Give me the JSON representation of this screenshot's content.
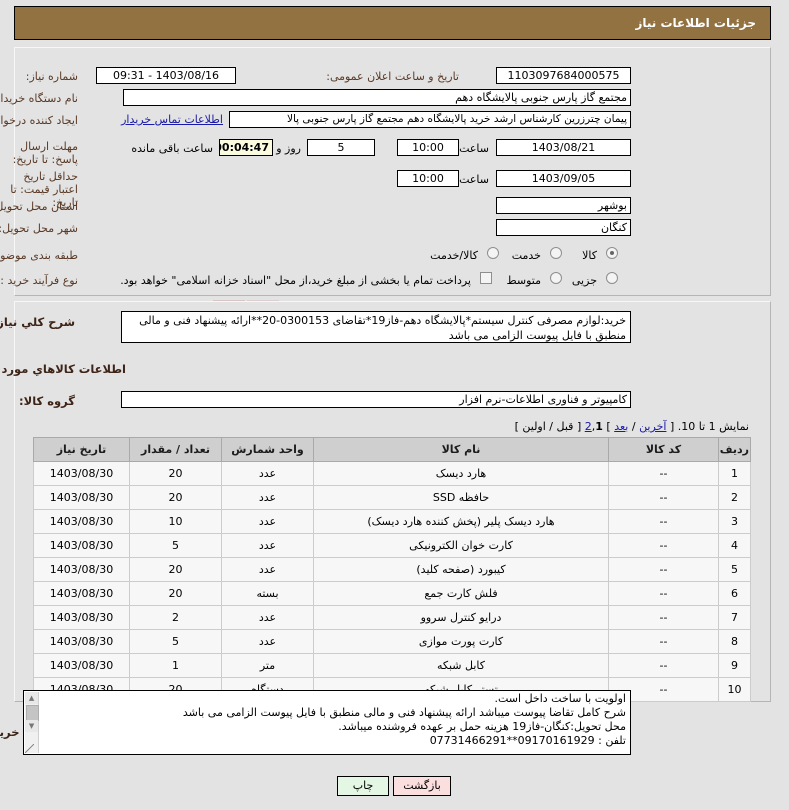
{
  "header": {
    "title": "جزئیات اطلاعات نیاز"
  },
  "form": {
    "need_number_label": "شماره نیاز:",
    "need_number_value": "1103097684000575",
    "announce_datetime_label": "تاریخ و ساعت اعلان عمومی:",
    "announce_datetime_value": "1403/08/16 - 09:31",
    "buyer_org_label": "نام دستگاه خریدار:",
    "buyer_org_value": "مجتمع گاز پارس جنوبی  پالایشگاه دهم",
    "requester_label": "ایجاد کننده درخواست:",
    "requester_value": "پیمان چترزرین کارشناس ارشد خرید پالایشگاه دهم مجتمع گاز پارس جنوبی  پالا",
    "buyer_contact_link": "اطلاعات تماس خریدار",
    "response_deadline_label": "مهلت ارسال پاسخ: تا تاریخ:",
    "response_deadline_date": "1403/08/21",
    "hour_label": "ساعت",
    "response_deadline_time": "10:00",
    "days_value": "5",
    "days_suffix_label": "روز و",
    "countdown_value": "00:04:47",
    "countdown_suffix_label": "ساعت باقی مانده",
    "price_validity_label": "حداقل تاریخ اعتبار قیمت: تا تاریخ:",
    "price_validity_date": "1403/09/05",
    "price_validity_time": "10:00",
    "province_label": "استان محل تحویل:",
    "province_value": "بوشهر",
    "city_label": "شهر محل تحویل:",
    "city_value": "کنگان",
    "category_label": "طبقه بندی موضوعی:",
    "category_options": [
      {
        "label": "کالا",
        "selected": true
      },
      {
        "label": "خدمت",
        "selected": false
      },
      {
        "label": "کالا/خدمت",
        "selected": false
      }
    ],
    "process_type_label": "نوع فرآیند خرید :",
    "process_type_options": [
      {
        "label": "جزیی",
        "selected": false
      },
      {
        "label": "متوسط",
        "selected": false
      }
    ],
    "treasury_checkbox_label": "پرداخت تمام یا بخشی از مبلغ خرید،از محل \"اسناد خزانه اسلامی\" خواهد بود.",
    "treasury_checked": false
  },
  "description": {
    "label": "شرح کلي نياز:",
    "value": "خرید:لوازم مصرفی کنترل سیستم*پالایشگاه دهم-فاز19*تقاضای 0300153-20**ارائه پیشنهاد فنی و مالی منطبق با فایل پیوست الزامی می باشد"
  },
  "goods_section": {
    "heading": "اطلاعات کالاهاي مورد نياز",
    "group_label": "گروه کالا:",
    "group_value": "کامپیوتر و فناوری اطلاعات-نرم افزار"
  },
  "pagination": {
    "prefix": "نمایش 1 تا 10. [",
    "last_link": "آخرین",
    "sep1": "/",
    "next_link": "بعد",
    "bracket_close": "]",
    "page2": "2",
    "comma": ",",
    "page1_current": "1",
    "bracket_open": "[",
    "prev_text": "قبل",
    "sep2": "/",
    "first_text": "اولین",
    "bracket_close2": "]"
  },
  "table": {
    "columns": [
      "ردیف",
      "کد کالا",
      "نام کالا",
      "واحد شمارش",
      "تعداد / مقدار",
      "تاریخ نیاز"
    ],
    "rows": [
      {
        "row": "1",
        "code": "--",
        "name": "هارد دیسک",
        "unit": "عدد",
        "qty": "20",
        "date": "1403/08/30"
      },
      {
        "row": "2",
        "code": "--",
        "name": "حافظه SSD",
        "unit": "عدد",
        "qty": "20",
        "date": "1403/08/30"
      },
      {
        "row": "3",
        "code": "--",
        "name": "هارد دیسک پلیر (پخش کننده هارد دیسک)",
        "unit": "عدد",
        "qty": "10",
        "date": "1403/08/30"
      },
      {
        "row": "4",
        "code": "--",
        "name": "کارت خوان الکترونیکی",
        "unit": "عدد",
        "qty": "5",
        "date": "1403/08/30"
      },
      {
        "row": "5",
        "code": "--",
        "name": "کیبورد (صفحه کلید)",
        "unit": "عدد",
        "qty": "20",
        "date": "1403/08/30"
      },
      {
        "row": "6",
        "code": "--",
        "name": "فلش کارت جمع",
        "unit": "بسته",
        "qty": "20",
        "date": "1403/08/30"
      },
      {
        "row": "7",
        "code": "--",
        "name": "درایو کنترل سروو",
        "unit": "عدد",
        "qty": "2",
        "date": "1403/08/30"
      },
      {
        "row": "8",
        "code": "--",
        "name": "کارت پورت موازی",
        "unit": "عدد",
        "qty": "5",
        "date": "1403/08/30"
      },
      {
        "row": "9",
        "code": "--",
        "name": "کابل شبکه",
        "unit": "متر",
        "qty": "1",
        "date": "1403/08/30"
      },
      {
        "row": "10",
        "code": "--",
        "name": "تستر کابل شبکه",
        "unit": "دستگاه",
        "qty": "20",
        "date": "1403/08/30"
      }
    ]
  },
  "notes": {
    "label": "توضیحات خریدار:",
    "lines": [
      "اولویت با ساخت داخل است.",
      "شرح کامل تقاضا پیوست میباشد ارائه پیشنهاد فنی و مالی منطبق با فایل پیوست الزامی می باشد",
      "محل تحویل:کنگان-فاز19 هزینه حمل بر عهده فروشنده میباشد.",
      "تلفن : 09170161929**07731466291"
    ]
  },
  "footer": {
    "print_label": "چاپ",
    "back_label": "بازگشت"
  },
  "watermark": {
    "text": "iranlender.net"
  },
  "colors": {
    "header_bg": "#937242",
    "label": "#5a3a26",
    "link": "#1a1aa8",
    "page_bg": "#e3e3e3",
    "print_btn": "#e4f7e4",
    "back_btn": "#fbdede",
    "countdown_bg": "#fbfbe0"
  }
}
